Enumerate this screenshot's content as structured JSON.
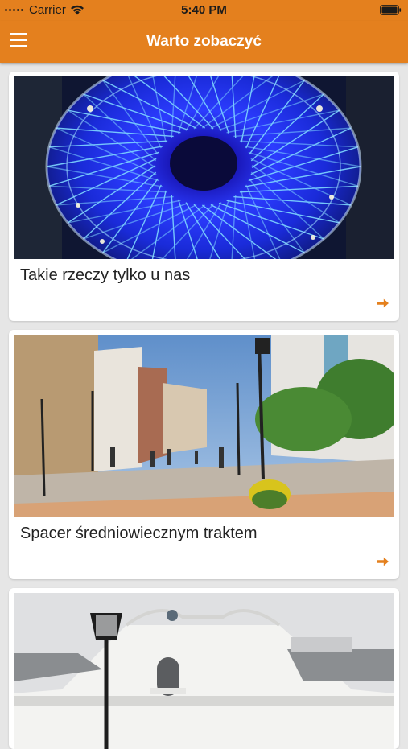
{
  "status_bar": {
    "carrier": "Carrier",
    "time": "5:40 PM",
    "icons": [
      "signal-dots-icon",
      "wifi-icon",
      "battery-icon"
    ]
  },
  "nav": {
    "title": "Warto zobaczyć",
    "menu_icon": "hamburger-menu-icon",
    "background_color": "#e4801e"
  },
  "cards": [
    {
      "title": "Takie rzeczy tylko u nas",
      "image": "blue-lit-dome-photo",
      "arrow_icon": "arrow-right-icon"
    },
    {
      "title": "Spacer średniowiecznym traktem",
      "image": "pedestrian-street-photo",
      "arrow_icon": "arrow-right-icon"
    },
    {
      "title": "",
      "image": "white-baroque-building-photo"
    }
  ],
  "colors": {
    "accent": "#e4801e",
    "arrow": "#e4801e",
    "page_background": "#e6e6e6"
  }
}
